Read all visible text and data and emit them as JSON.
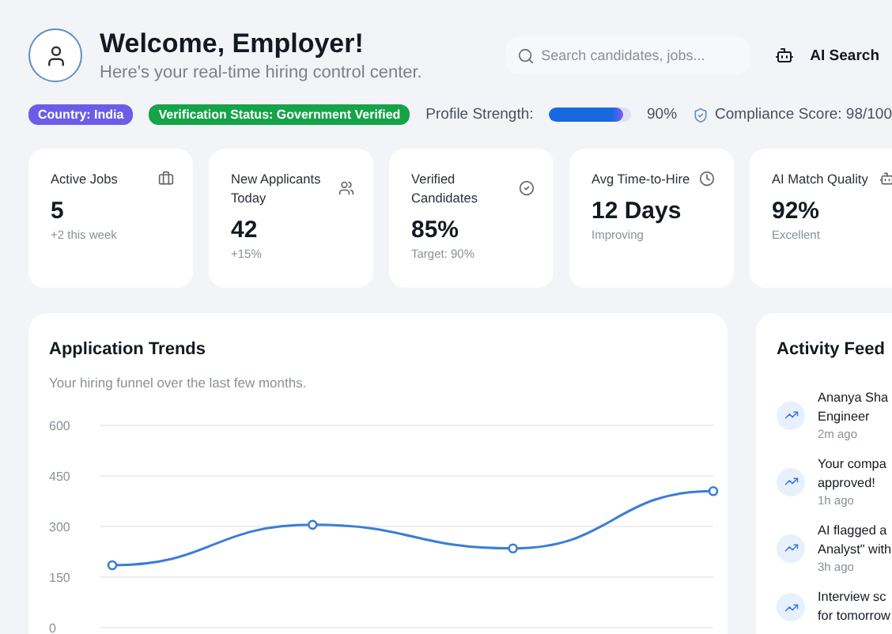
{
  "header": {
    "title": "Welcome, Employer!",
    "subtitle": "Here's your real-time hiring control center.",
    "search": {
      "placeholder": "Search candidates, jobs..."
    },
    "ai_button": "AI Search"
  },
  "badges": [
    {
      "label": "Country: India",
      "color": "#6c5ce7"
    },
    {
      "label": "Verification Status: Government Verified",
      "color": "#16a34a"
    }
  ],
  "profile_strength": {
    "label": "Profile Strength:",
    "level": 0.9,
    "reading": "90%"
  },
  "compliance": "Compliance Score: 98/100",
  "stats": [
    {
      "kind": "briefcase",
      "label": "Active Jobs",
      "value": "5",
      "note": "+2 this week"
    },
    {
      "kind": "users",
      "label": "New Applicants Today",
      "value": "42",
      "note": "+15%"
    },
    {
      "kind": "check",
      "label": "Verified Candidates",
      "value": "85%",
      "note": "Target: 90%"
    },
    {
      "kind": "clock",
      "label": "Avg Time-to-Hire",
      "value": "12 Days",
      "note": "Improving"
    },
    {
      "kind": "bot",
      "label": "AI Match Quality",
      "value": "92%",
      "note": "Excellent"
    }
  ],
  "trends": {
    "title": "Application Trends",
    "subtitle": "Your hiring funnel over the last few months.",
    "chart_data": {
      "type": "line",
      "ylim": [
        0,
        600
      ],
      "yticks": [
        0,
        150,
        300,
        450,
        600
      ],
      "grid": true,
      "series": [
        {
          "color": "#3b7dd8",
          "marker": "circle",
          "values": [
            185,
            305,
            235,
            405
          ]
        }
      ]
    }
  },
  "activity": {
    "title": "Activity Feed",
    "items": [
      {
        "lines": [
          "Ananya Sha",
          "Engineer"
        ],
        "time": "2m ago"
      },
      {
        "lines": [
          "Your compa",
          "approved!"
        ],
        "time": "1h ago"
      },
      {
        "lines": [
          "AI flagged a",
          "Analyst\" with"
        ],
        "time": "3h ago"
      },
      {
        "lines": [
          "Interview sc",
          "for tomorrow"
        ]
      }
    ]
  }
}
